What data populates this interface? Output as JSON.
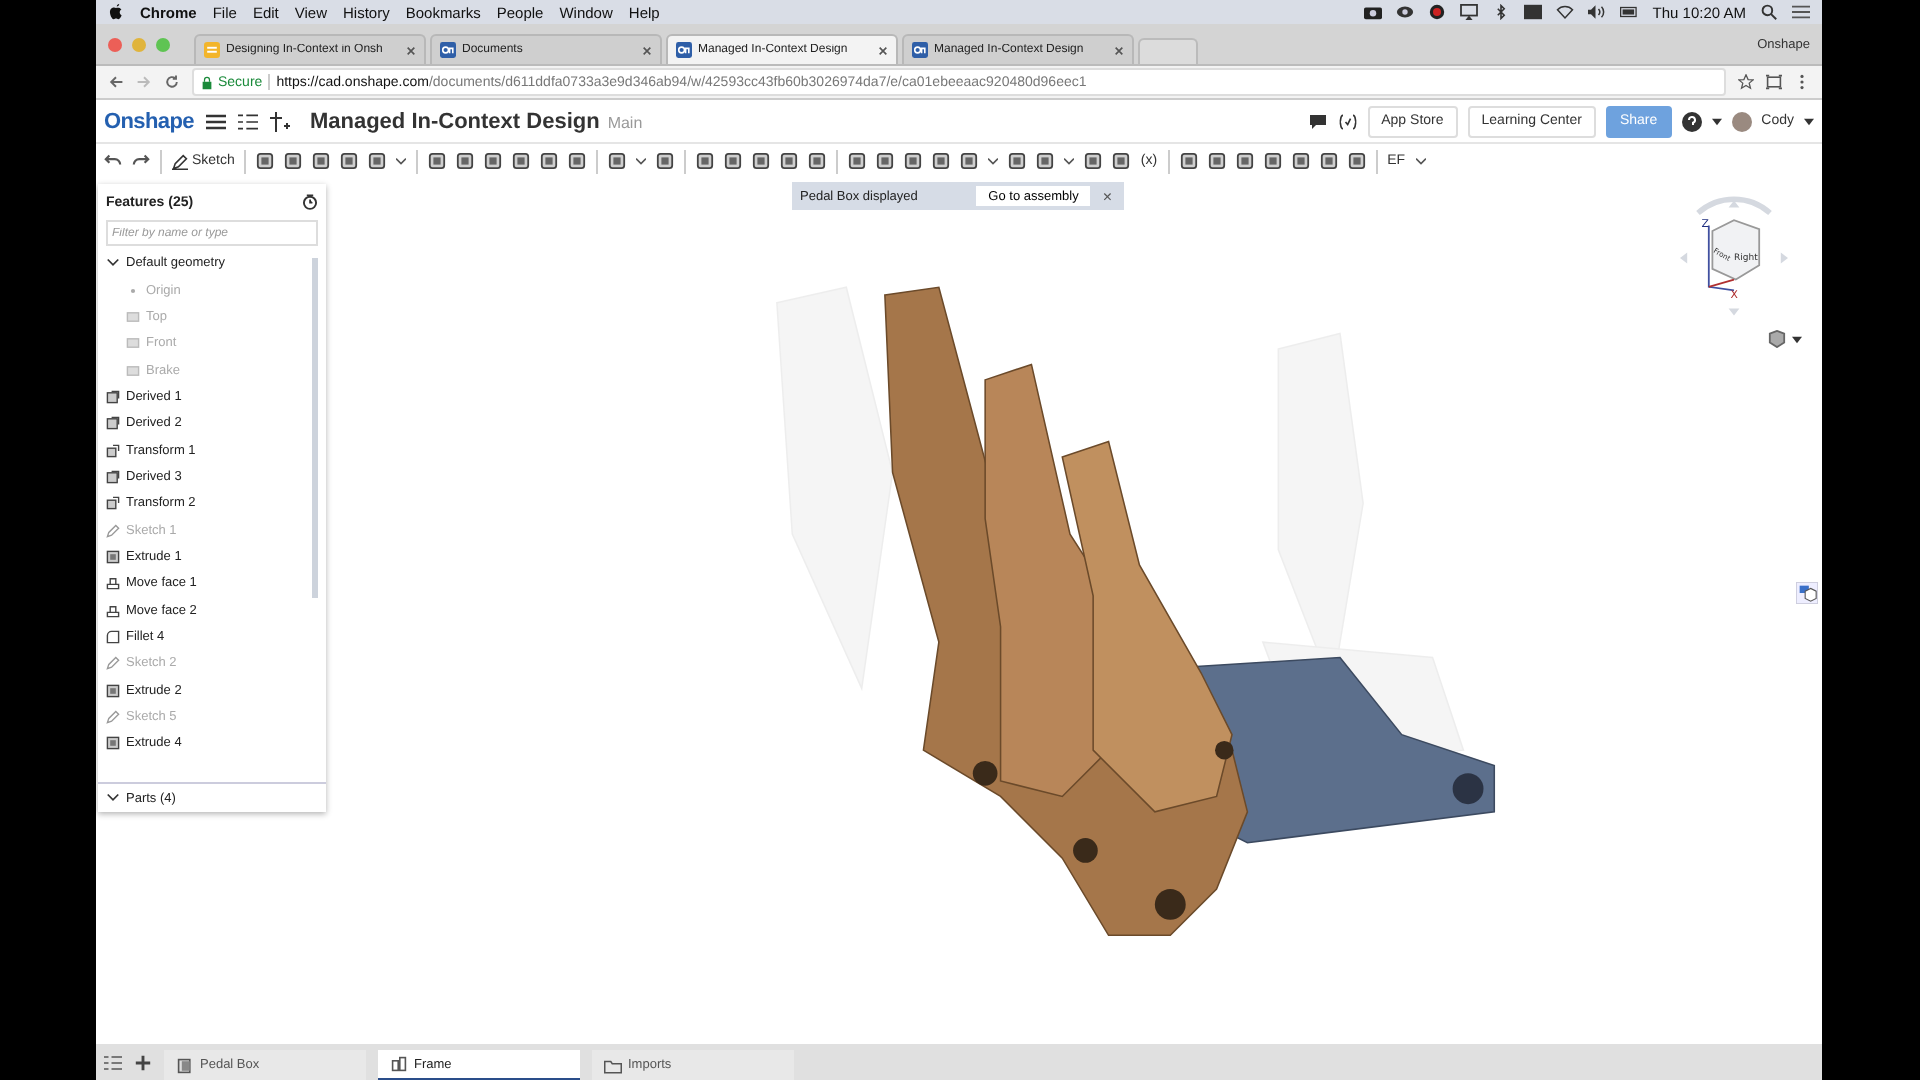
{
  "menu_bar": {
    "app": "Chrome",
    "items": [
      "File",
      "Edit",
      "View",
      "History",
      "Bookmarks",
      "People",
      "Window",
      "Help"
    ],
    "clock": "Thu 10:20 AM"
  },
  "browser_tabs": [
    {
      "title": "Designing In-Context in Onsh",
      "kind": "doc",
      "selected": false
    },
    {
      "title": "Documents",
      "kind": "onshape",
      "selected": false
    },
    {
      "title": "Managed In-Context Design",
      "kind": "onshape",
      "selected": true
    },
    {
      "title": "Managed In-Context Design",
      "kind": "onshape",
      "selected": false
    }
  ],
  "profile_label": "Onshape",
  "address_bar": {
    "secure_label": "Secure",
    "url_host": "https://cad.onshape.com",
    "url_path": "/documents/d611ddfa0733a3e9d346ab94/w/42593cc43fb60b3026974da7/e/ca01ebeeaac920480d96eec1"
  },
  "app_header": {
    "logo": "Onshape",
    "document_title": "Managed In-Context Design",
    "branch": "Main",
    "buttons": [
      "App Store",
      "Learning Center"
    ],
    "share": "Share",
    "user": "Cody"
  },
  "toolbar": [
    {
      "kind": "undo"
    },
    {
      "kind": "redo"
    },
    {
      "kind": "sep"
    },
    {
      "kind": "sketch",
      "label": "Sketch"
    },
    {
      "kind": "sep"
    },
    {
      "kind": "icon"
    },
    {
      "kind": "icon"
    },
    {
      "kind": "icon"
    },
    {
      "kind": "icon"
    },
    {
      "kind": "icon"
    },
    {
      "kind": "caret"
    },
    {
      "kind": "sep"
    },
    {
      "kind": "icon"
    },
    {
      "kind": "icon"
    },
    {
      "kind": "icon"
    },
    {
      "kind": "icon"
    },
    {
      "kind": "icon"
    },
    {
      "kind": "icon"
    },
    {
      "kind": "sep"
    },
    {
      "kind": "icon"
    },
    {
      "kind": "caret"
    },
    {
      "kind": "icon"
    },
    {
      "kind": "sep"
    },
    {
      "kind": "icon"
    },
    {
      "kind": "icon"
    },
    {
      "kind": "icon"
    },
    {
      "kind": "icon"
    },
    {
      "kind": "icon"
    },
    {
      "kind": "sep"
    },
    {
      "kind": "icon"
    },
    {
      "kind": "icon"
    },
    {
      "kind": "icon"
    },
    {
      "kind": "icon"
    },
    {
      "kind": "icon"
    },
    {
      "kind": "caret"
    },
    {
      "kind": "icon"
    },
    {
      "kind": "icon"
    },
    {
      "kind": "caret"
    },
    {
      "kind": "icon"
    },
    {
      "kind": "icon"
    },
    {
      "kind": "text",
      "label": "(x)"
    },
    {
      "kind": "sep"
    },
    {
      "kind": "icon"
    },
    {
      "kind": "icon"
    },
    {
      "kind": "icon"
    },
    {
      "kind": "icon"
    },
    {
      "kind": "icon"
    },
    {
      "kind": "icon"
    },
    {
      "kind": "icon"
    },
    {
      "kind": "sep"
    },
    {
      "kind": "text",
      "label": "EF"
    },
    {
      "kind": "caret"
    }
  ],
  "notice": {
    "text": "Pedal Box displayed",
    "action": "Go to assembly",
    "close": "×"
  },
  "features": {
    "title": "Features (25)",
    "filter_placeholder": "Filter by name or type",
    "items": [
      {
        "label": "Default geometry",
        "kind": "group",
        "dimmed": false,
        "children": [
          {
            "label": "Origin",
            "kind": "origin",
            "dimmed": true
          },
          {
            "label": "Top",
            "kind": "plane",
            "dimmed": true
          },
          {
            "label": "Front",
            "kind": "plane",
            "dimmed": true
          },
          {
            "label": "Brake",
            "kind": "plane",
            "dimmed": true
          }
        ]
      },
      {
        "label": "Derived 1",
        "kind": "derived",
        "dimmed": false
      },
      {
        "label": "Derived 2",
        "kind": "derived",
        "dimmed": false
      },
      {
        "label": "Transform 1",
        "kind": "transform",
        "dimmed": false
      },
      {
        "label": "Derived 3",
        "kind": "derived",
        "dimmed": false
      },
      {
        "label": "Transform 2",
        "kind": "transform",
        "dimmed": false
      },
      {
        "label": "Sketch 1",
        "kind": "sketch",
        "dimmed": true
      },
      {
        "label": "Extrude 1",
        "kind": "extrude",
        "dimmed": false
      },
      {
        "label": "Move face 1",
        "kind": "move",
        "dimmed": false
      },
      {
        "label": "Move face 2",
        "kind": "move",
        "dimmed": false
      },
      {
        "label": "Fillet 4",
        "kind": "fillet",
        "dimmed": false
      },
      {
        "label": "Sketch 2",
        "kind": "sketch",
        "dimmed": true
      },
      {
        "label": "Extrude 2",
        "kind": "extrude",
        "dimmed": false
      },
      {
        "label": "Sketch 5",
        "kind": "sketch",
        "dimmed": true
      },
      {
        "label": "Extrude 4",
        "kind": "extrude",
        "dimmed": false
      }
    ],
    "parts": "Parts (4)"
  },
  "view_cube": {
    "faces": [
      "Right",
      "Front"
    ],
    "axes": [
      "Z",
      "X"
    ]
  },
  "bottom_tabs": [
    {
      "label": "Pedal Box",
      "kind": "assembly",
      "selected": false
    },
    {
      "label": "Frame",
      "kind": "partstudio",
      "selected": true
    },
    {
      "label": "Imports",
      "kind": "folder",
      "selected": false
    }
  ]
}
